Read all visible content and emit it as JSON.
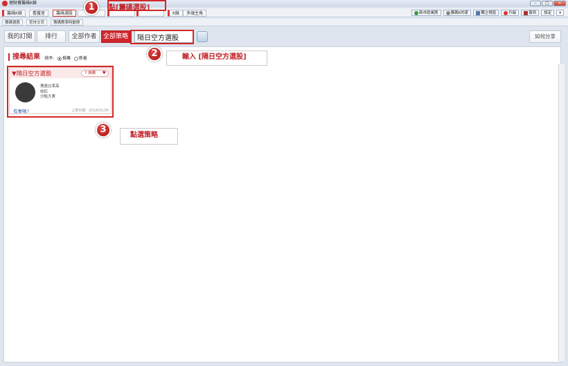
{
  "window": {
    "title": "理財寶籌碼K線"
  },
  "menu": {
    "items": [
      "籌碼K線",
      "看盤室",
      "籌碼選股",
      "",
      "",
      "",
      "K線",
      "多頭主角"
    ]
  },
  "right_tools": [
    "新市助風險",
    "籌碼K的家",
    "獨立視窗",
    "升級",
    "簽到",
    "設定"
  ],
  "subtabs": [
    "籌碼選股",
    "密技交流",
    "籌碼教學時動態"
  ],
  "toolbar": {
    "my_subscriptions": "我的訂閱",
    "ranking": "排行",
    "all_authors": "全部作者",
    "all_strategies": "全部策略",
    "search_value": "隔日空方選股",
    "share": "如何分享"
  },
  "results": {
    "title": "搜尋結果",
    "sort_label": "排序:",
    "sort_recommend": "推薦",
    "sort_newest": "新着"
  },
  "card": {
    "name": "▼隔日空方選股",
    "badge": "7 推薦",
    "tags": [
      "賣座比率高",
      "收紅",
      "分點大賣"
    ],
    "question": "有事嗎?",
    "date": "上架日期：2018/01/26"
  },
  "annotations": {
    "step1_num": "1",
    "step1_label": "點[籌碼選股]",
    "step2_num": "2",
    "step2_label": "輸入 [隔日空方選股]",
    "step3_num": "3",
    "step3_label": "點選策略"
  },
  "colors": {
    "accent": "#d0262c",
    "annotation": "#d42626"
  }
}
